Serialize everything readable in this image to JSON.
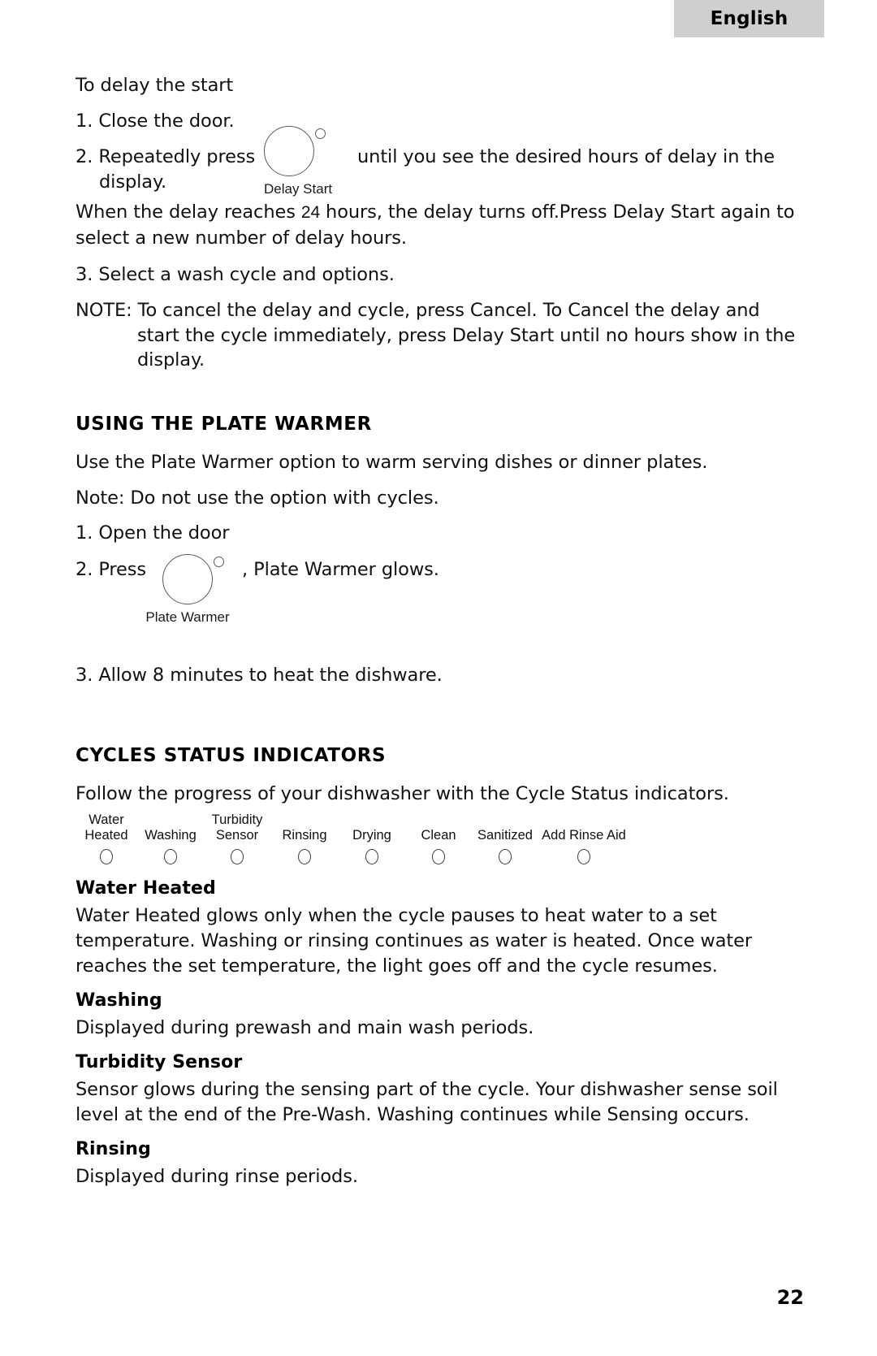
{
  "header": {
    "language_tab": "English"
  },
  "delay_section": {
    "heading": "To delay the start",
    "step1": "1. Close the door.",
    "step2_before": "2. Repeatedly press",
    "step2_after": "until you see the desired hours of delay in the",
    "step2_line2": "display.",
    "reach_line_a": "When the delay reaches",
    "reach_hours": "24",
    "reach_line_b": "hours, the delay turns off.Press Delay Start again to",
    "reach_line2": "select a new number of delay hours.",
    "step3": "3. Select a wash cycle and options.",
    "note_line1": "NOTE: To cancel the delay and cycle, press Cancel. To Cancel the delay and",
    "note_line2": "start the cycle immediately, press Delay Start until no hours show in the",
    "note_line3": "display.",
    "button": {
      "caption": "Delay Start",
      "icon": "round-button-with-led"
    }
  },
  "plate_warmer_section": {
    "heading": "USING THE PLATE WARMER",
    "intro": "Use the Plate Warmer option to warm serving dishes or dinner plates.",
    "note": "Note: Do not use the option with cycles.",
    "step1": "1. Open the door",
    "step2_before": "2. Press",
    "step2_after": ", Plate Warmer glows.",
    "step3": "3. Allow 8 minutes to heat the dishware.",
    "button": {
      "caption": "Plate Warmer",
      "icon": "round-button-with-led"
    }
  },
  "cycles_section": {
    "heading": "CYCLES STATUS INDICATORS",
    "intro": "Follow the progress of your dishwasher with the Cycle Status indicators.",
    "indicators": [
      {
        "label": "Water\nHeated"
      },
      {
        "label": "Washing"
      },
      {
        "label": "Turbidity\nSensor"
      },
      {
        "label": "Rinsing"
      },
      {
        "label": "Drying"
      },
      {
        "label": "Clean"
      },
      {
        "label": "Sanitized"
      },
      {
        "label": "Add Rinse Aid"
      }
    ],
    "entries": [
      {
        "title": "Water Heated",
        "body_line1": "Water Heated glows only when the cycle pauses to heat water to a set",
        "body_line2": "temperature. Washing or rinsing continues as water is heated. Once water",
        "body_line3": "reaches the set temperature, the light goes off and the cycle resumes."
      },
      {
        "title": "Washing",
        "body_line1": "Displayed during prewash and main wash periods.",
        "body_line2": "",
        "body_line3": ""
      },
      {
        "title": "Turbidity Sensor",
        "body_line1": "Sensor glows during the sensing part of the cycle. Your dishwasher sense soil",
        "body_line2": "level at the end of the Pre-Wash. Washing continues while Sensing occurs.",
        "body_line3": ""
      },
      {
        "title": "Rinsing",
        "body_line1": "Displayed during rinse periods.",
        "body_line2": "",
        "body_line3": ""
      }
    ]
  },
  "footer": {
    "page_number": "22"
  },
  "colors": {
    "tab_background": "#cfcfcf",
    "text": "#111111",
    "icon_stroke": "#5b5b5b"
  }
}
